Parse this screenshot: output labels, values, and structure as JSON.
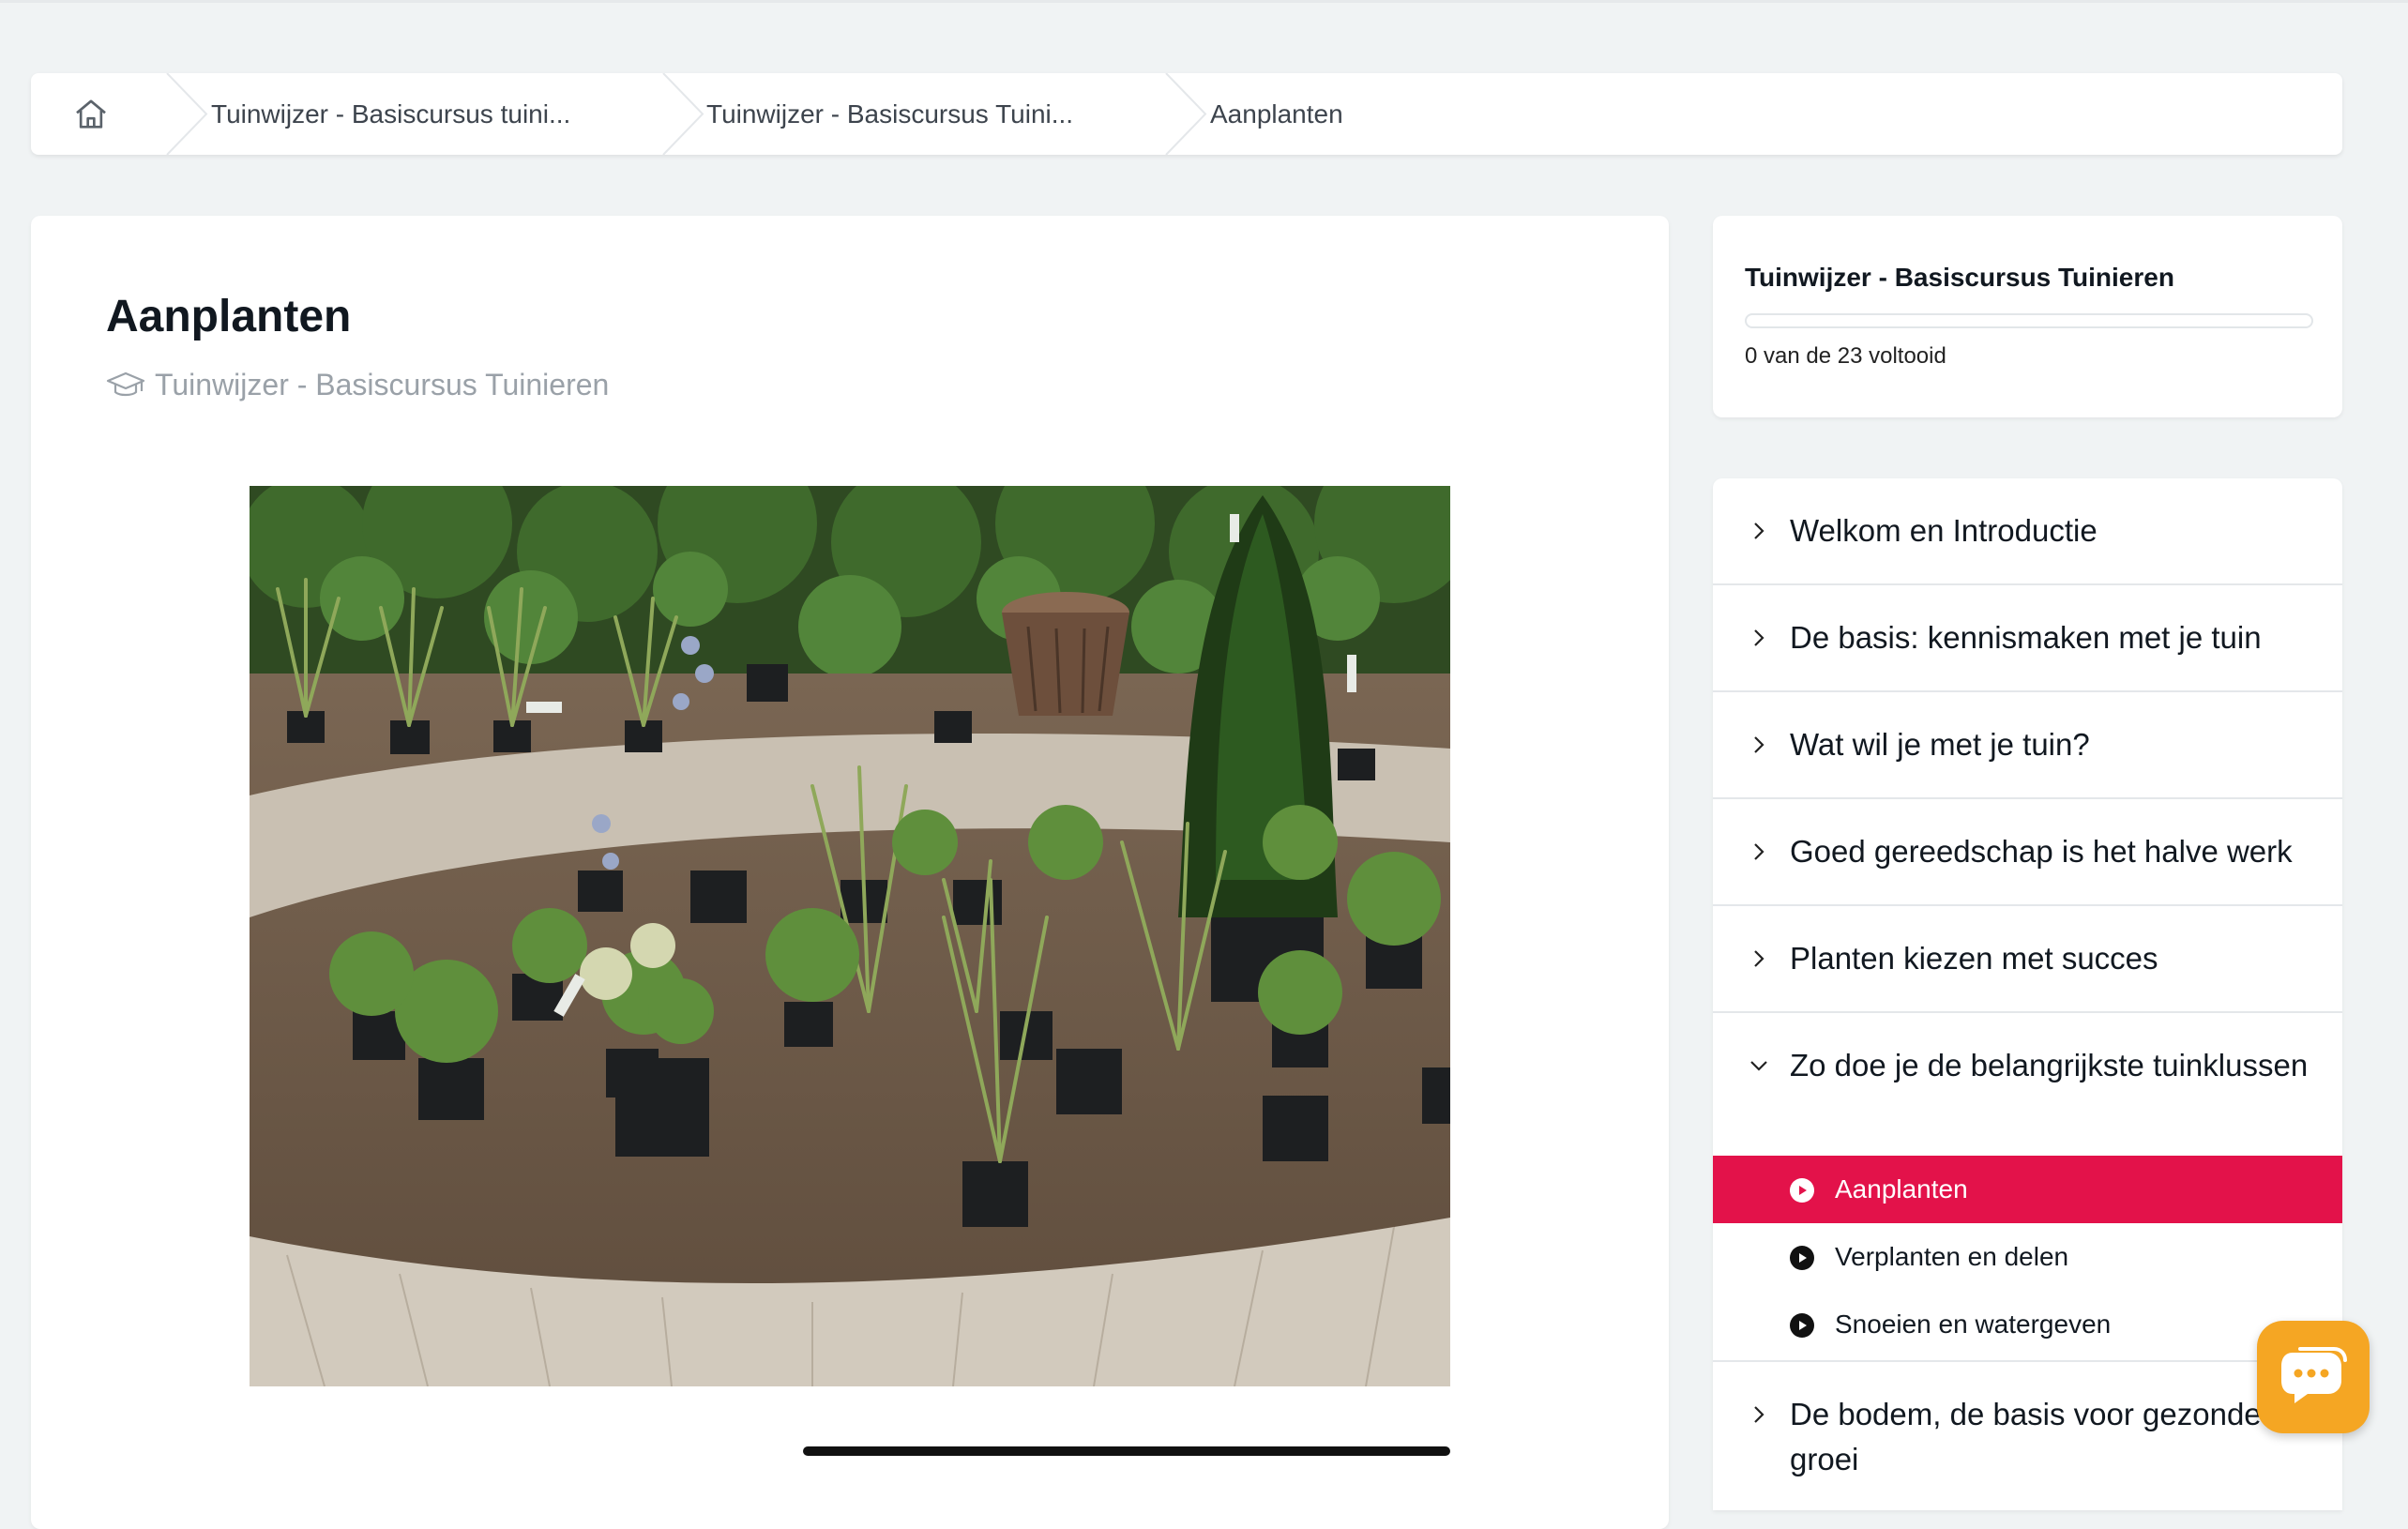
{
  "breadcrumb": {
    "home_icon": "home-icon",
    "items": [
      {
        "label": "Tuinwijzer - Basiscursus tuini..."
      },
      {
        "label": "Tuinwijzer - Basiscursus Tuini..."
      },
      {
        "label": "Aanplanten"
      }
    ]
  },
  "lesson": {
    "title": "Aanplanten",
    "course_icon": "graduation-cap-icon",
    "course_name": "Tuinwijzer - Basiscursus Tuinieren",
    "media": "garden-planting-photo",
    "video_progress": 1.0
  },
  "progress": {
    "course_title": "Tuinwijzer - Basiscursus Tuinieren",
    "fraction": 0,
    "status": "0 van de 23 voltooid"
  },
  "modules": [
    {
      "label": "Welkom en Introductie",
      "expanded": false
    },
    {
      "label": "De basis: kennismaken met je tuin",
      "expanded": false
    },
    {
      "label": "Wat wil je met je tuin?",
      "expanded": false
    },
    {
      "label": "Goed gereedschap is het halve werk",
      "expanded": false
    },
    {
      "label": "Planten kiezen met succes",
      "expanded": false
    },
    {
      "label": "Zo doe je de belangrijkste tuinklussen",
      "expanded": true,
      "lessons": [
        {
          "label": "Aanplanten",
          "active": true
        },
        {
          "label": "Verplanten en delen",
          "active": false
        },
        {
          "label": "Snoeien en watergeven",
          "active": false
        }
      ]
    },
    {
      "label": "De bodem, de basis voor gezonde groei",
      "expanded": false
    }
  ],
  "chat": {
    "icon": "chat-bubble-icon"
  },
  "colors": {
    "accent": "#e3124a",
    "chat": "#f5a623",
    "background": "#f0f3f4"
  }
}
